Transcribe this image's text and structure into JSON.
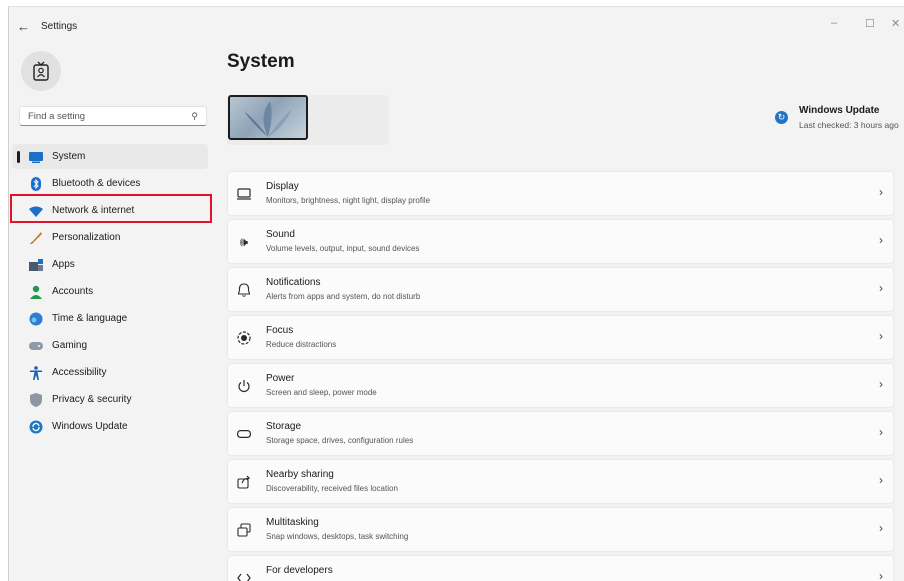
{
  "window": {
    "title": "Settings",
    "back_glyph": "←",
    "minimize_glyph": "–",
    "maximize_glyph": "☐",
    "close_glyph": "✕"
  },
  "search": {
    "placeholder": "Find a setting",
    "icon": "search-icon"
  },
  "sidebar": {
    "items": [
      {
        "label": "System",
        "icon": "system-icon",
        "active": true
      },
      {
        "label": "Bluetooth & devices",
        "icon": "bluetooth-icon"
      },
      {
        "label": "Network & internet",
        "icon": "wifi-icon",
        "highlighted": true
      },
      {
        "label": "Personalization",
        "icon": "brush-icon"
      },
      {
        "label": "Apps",
        "icon": "apps-icon"
      },
      {
        "label": "Accounts",
        "icon": "account-icon"
      },
      {
        "label": "Time & language",
        "icon": "globe-icon"
      },
      {
        "label": "Gaming",
        "icon": "gamepad-icon"
      },
      {
        "label": "Accessibility",
        "icon": "accessibility-icon"
      },
      {
        "label": "Privacy & security",
        "icon": "shield-icon"
      },
      {
        "label": "Windows Update",
        "icon": "update-icon"
      }
    ]
  },
  "main": {
    "title": "System",
    "windows_update": {
      "title": "Windows Update",
      "subtitle": "Last checked: 3 hours ago"
    },
    "cards": [
      {
        "title": "Display",
        "subtitle": "Monitors, brightness, night light, display profile",
        "icon": "monitor-icon"
      },
      {
        "title": "Sound",
        "subtitle": "Volume levels, output, input, sound devices",
        "icon": "speaker-icon"
      },
      {
        "title": "Notifications",
        "subtitle": "Alerts from apps and system, do not disturb",
        "icon": "bell-icon"
      },
      {
        "title": "Focus",
        "subtitle": "Reduce distractions",
        "icon": "focus-icon"
      },
      {
        "title": "Power",
        "subtitle": "Screen and sleep, power mode",
        "icon": "power-icon"
      },
      {
        "title": "Storage",
        "subtitle": "Storage space, drives, configuration rules",
        "icon": "storage-icon"
      },
      {
        "title": "Nearby sharing",
        "subtitle": "Discoverability, received files location",
        "icon": "share-icon"
      },
      {
        "title": "Multitasking",
        "subtitle": "Snap windows, desktops, task switching",
        "icon": "multitask-icon"
      },
      {
        "title": "For developers",
        "subtitle": "",
        "icon": "developer-icon"
      }
    ]
  },
  "colors": {
    "accent": "#0067c0",
    "highlight_border": "#e3122a"
  }
}
